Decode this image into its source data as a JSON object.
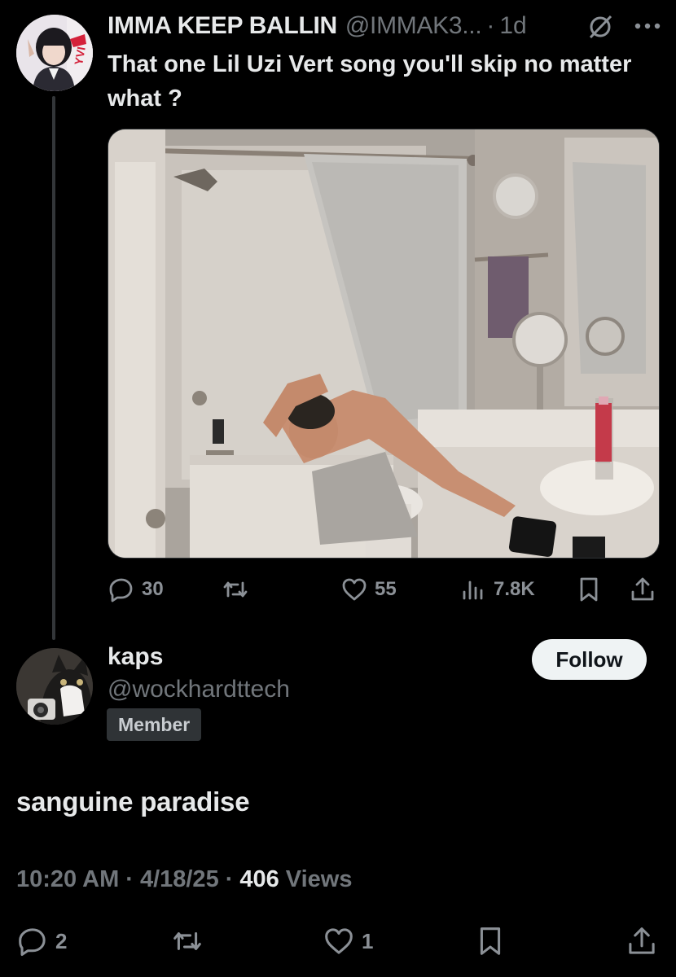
{
  "parent_tweet": {
    "author_name": "IMMA KEEP BALLIN",
    "author_handle": "@IMMAK3...",
    "separator": "·",
    "time": "1d",
    "text": "That one Lil Uzi Vert song you'll skip no matter what ?",
    "avatar_badge_text": "YVI",
    "stats": {
      "replies": "30",
      "likes": "55",
      "views": "7.8K"
    },
    "icons": [
      "grok-icon",
      "more-icon",
      "reply-icon",
      "retweet-icon",
      "like-icon",
      "views-icon",
      "bookmark-icon",
      "share-icon"
    ]
  },
  "reply": {
    "author_name": "kaps",
    "author_handle": "@wockhardttech",
    "badge": "Member",
    "follow_label": "Follow",
    "text": "sanguine paradise",
    "time": "10:20 AM",
    "date": "4/18/25",
    "views_count": "406",
    "views_label": "Views",
    "separator": "·",
    "stats": {
      "replies": "2",
      "likes": "1"
    }
  },
  "colors": {
    "background": "#000000",
    "primary_text": "#e7e9ea",
    "secondary_text": "#71767b",
    "follow_button_bg": "#eff3f4"
  }
}
